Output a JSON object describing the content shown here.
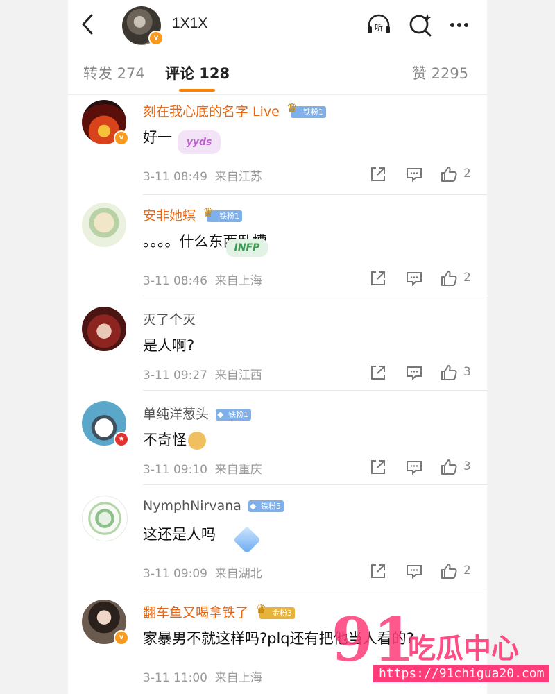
{
  "header": {
    "name": "1X1X",
    "listen_label": "听"
  },
  "tabs": [
    {
      "label": "转发 274"
    },
    {
      "label": "评论 128"
    },
    {
      "label": "赞 2295"
    }
  ],
  "comments": [
    {
      "name": "刻在我心底的名字 Live",
      "badge": "铁粉1",
      "text": "好一",
      "sticker": "yyds",
      "time": "3-11 08:49",
      "location": "来自江苏",
      "likes": "2"
    },
    {
      "name": "安非她螟",
      "badge": "铁粉1",
      "text": "。。。。什么东西卧槽",
      "sticker": "INFP",
      "time": "3-11 08:46",
      "location": "来自上海",
      "likes": "2"
    },
    {
      "name": "灭了个灭",
      "badge": "",
      "text": "是人啊?",
      "sticker": "",
      "time": "3-11 09:27",
      "location": "来自江西",
      "likes": "3"
    },
    {
      "name": "单纯洋葱头",
      "badge": "铁粉1",
      "text": "不奇怪",
      "sticker": "",
      "time": "3-11 09:10",
      "location": "来自重庆",
      "likes": "3"
    },
    {
      "name": "NymphNirvana",
      "badge": "铁粉5",
      "text": "这还是人吗",
      "sticker": "",
      "time": "3-11 09:09",
      "location": "来自湖北",
      "likes": "2"
    },
    {
      "name": "翻车鱼又喝拿铁了",
      "badge": "金粉3",
      "text": "家暴男不就这样吗?plq还有把他当人看的?",
      "sticker": "",
      "time": "3-11 11:00",
      "location": "来自上海",
      "likes": ""
    }
  ],
  "watermark": {
    "number": "91",
    "text": "吃瓜中心",
    "url": "https://91chigua20.com"
  },
  "colors": {
    "accent": "#ff8200",
    "vip_name": "#e8660f",
    "fan_badge": "#7fb0ea",
    "gold_badge": "#e8b23b",
    "watermark": "#ff3b79"
  }
}
